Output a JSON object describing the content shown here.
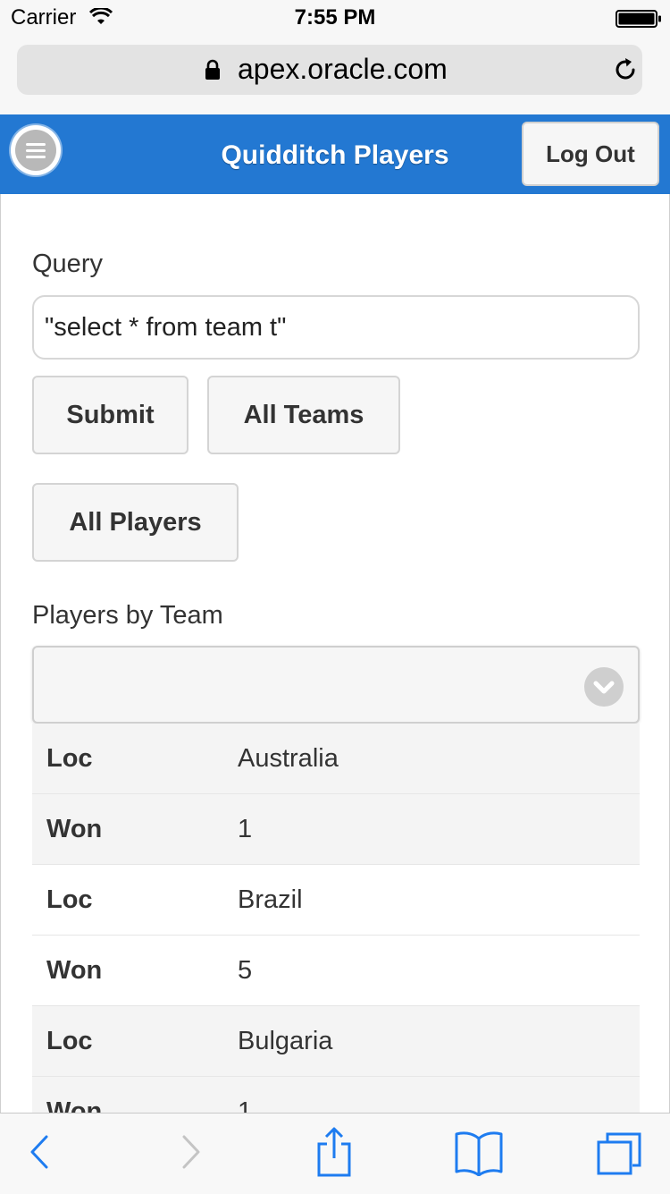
{
  "status_bar": {
    "carrier": "Carrier",
    "time": "7:55 PM",
    "wifi_icon": "wifi-icon",
    "battery_icon": "battery-icon"
  },
  "browser": {
    "url": "apex.oracle.com",
    "secure_icon": "lock-icon",
    "reload_icon": "reload-icon"
  },
  "header": {
    "title": "Quidditch Players",
    "logout_label": "Log Out",
    "menu_icon": "hamburger-menu-icon",
    "background": "#2378d2"
  },
  "query": {
    "label": "Query",
    "value": "\"select * from team t\""
  },
  "buttons": {
    "submit": "Submit",
    "all_teams": "All Teams",
    "all_players": "All Players"
  },
  "players_by_team": {
    "label": "Players by Team",
    "selected_value": "",
    "chevron_icon": "chevron-down-icon"
  },
  "rows": [
    {
      "key": "Loc",
      "value": "Australia"
    },
    {
      "key": "Won",
      "value": "1"
    },
    {
      "key": "Loc",
      "value": "Brazil"
    },
    {
      "key": "Won",
      "value": "5"
    },
    {
      "key": "Loc",
      "value": "Bulgaria"
    },
    {
      "key": "Won",
      "value": "1"
    }
  ],
  "toolbar": {
    "back_icon": "back-icon",
    "forward_icon": "forward-icon",
    "share_icon": "share-icon",
    "bookmarks_icon": "bookmarks-icon",
    "tabs_icon": "tabs-icon",
    "accent": "#1e7cf0"
  }
}
